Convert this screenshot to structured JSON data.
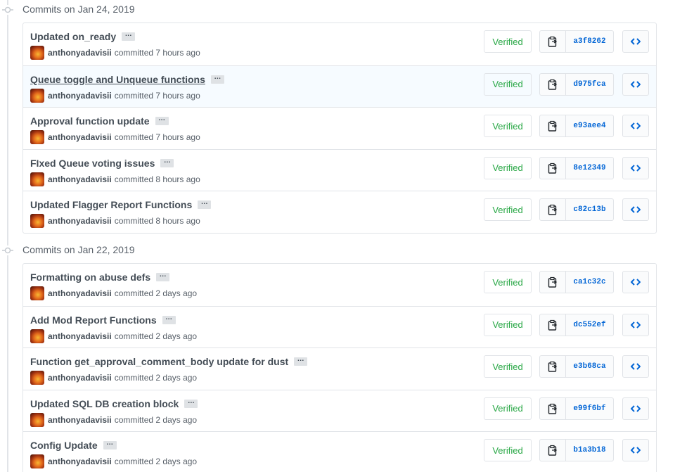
{
  "groups": [
    {
      "title": "Commits on Jan 24, 2019",
      "commits": [
        {
          "message": "Updated on_ready",
          "author": "anthonyadavisii",
          "time": "committed 7 hours ago",
          "verified": "Verified",
          "sha": "a3f8262"
        },
        {
          "message": "Queue toggle and Unqueue functions",
          "author": "anthonyadavisii",
          "time": "committed 7 hours ago",
          "verified": "Verified",
          "sha": "d975fca"
        },
        {
          "message": "Approval function update",
          "author": "anthonyadavisii",
          "time": "committed 7 hours ago",
          "verified": "Verified",
          "sha": "e93aee4"
        },
        {
          "message": "FIxed Queue voting issues",
          "author": "anthonyadavisii",
          "time": "committed 8 hours ago",
          "verified": "Verified",
          "sha": "8e12349"
        },
        {
          "message": "Updated Flagger Report Functions",
          "author": "anthonyadavisii",
          "time": "committed 8 hours ago",
          "verified": "Verified",
          "sha": "c82c13b"
        }
      ]
    },
    {
      "title": "Commits on Jan 22, 2019",
      "commits": [
        {
          "message": "Formatting on abuse defs",
          "author": "anthonyadavisii",
          "time": "committed 2 days ago",
          "verified": "Verified",
          "sha": "ca1c32c"
        },
        {
          "message": "Add Mod Report Functions",
          "author": "anthonyadavisii",
          "time": "committed 2 days ago",
          "verified": "Verified",
          "sha": "dc552ef"
        },
        {
          "message": "Function get_approval_comment_body update for dust",
          "author": "anthonyadavisii",
          "time": "committed 2 days ago",
          "verified": "Verified",
          "sha": "e3b68ca"
        },
        {
          "message": "Updated SQL DB creation block",
          "author": "anthonyadavisii",
          "time": "committed 2 days ago",
          "verified": "Verified",
          "sha": "e99f6bf"
        },
        {
          "message": "Config Update",
          "author": "anthonyadavisii",
          "time": "committed 2 days ago",
          "verified": "Verified",
          "sha": "b1a3b18"
        }
      ]
    }
  ],
  "ellipsis_label": "…",
  "icons": {
    "group": "git-commit-icon",
    "copy": "clipboard-icon",
    "browse": "code-icon"
  },
  "colors": {
    "verified": "#28a745",
    "sha": "#0366d6",
    "highlight_row": "#f6fbff"
  }
}
